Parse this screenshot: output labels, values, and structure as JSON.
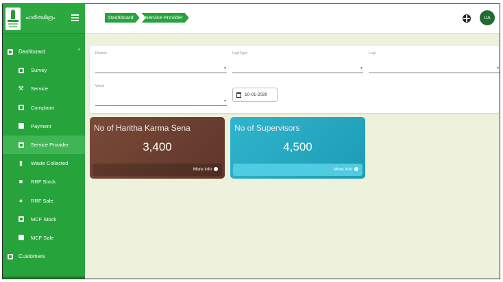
{
  "brand": {
    "text": "ഹരിതമിത്രം"
  },
  "sidebar": {
    "items": [
      {
        "label": "Dashboard",
        "icon": "dashboard-icon",
        "caret": "^"
      },
      {
        "label": "Survey",
        "icon": "survey-icon"
      },
      {
        "label": "Service",
        "icon": "service-icon"
      },
      {
        "label": "Complaint",
        "icon": "complaint-icon"
      },
      {
        "label": "Payment",
        "icon": "payment-icon"
      },
      {
        "label": "Service Provider",
        "icon": "service-provider-icon"
      },
      {
        "label": "Waste Collected",
        "icon": "waste-icon"
      },
      {
        "label": "RRF Stock",
        "icon": "rrf-stock-icon"
      },
      {
        "label": "RRF Sale",
        "icon": "rrf-sale-icon"
      },
      {
        "label": "MCF Stock",
        "icon": "mcf-stock-icon"
      },
      {
        "label": "MCF Sale",
        "icon": "mcf-sale-icon"
      },
      {
        "label": "Customers",
        "icon": "customers-icon"
      }
    ]
  },
  "header": {
    "breadcrumb": [
      "Dashboard",
      "Service Provider"
    ],
    "avatar_initials": "UA"
  },
  "filters": {
    "district": "District",
    "lsgi_type": "LsgiType",
    "lsgi": "Lsgi",
    "ward": "Ward",
    "date": "10-01-2020"
  },
  "cards": [
    {
      "title": "No of Haritha Karma Sena",
      "value": "3,400",
      "more": "More info"
    },
    {
      "title": "No of Supervisors",
      "value": "4,500",
      "more": "More info"
    }
  ],
  "colors": {
    "sidebar": "#27a33c",
    "background": "#eef1dc",
    "card_brown": "#6b3f31",
    "card_cyan": "#28adc6"
  }
}
